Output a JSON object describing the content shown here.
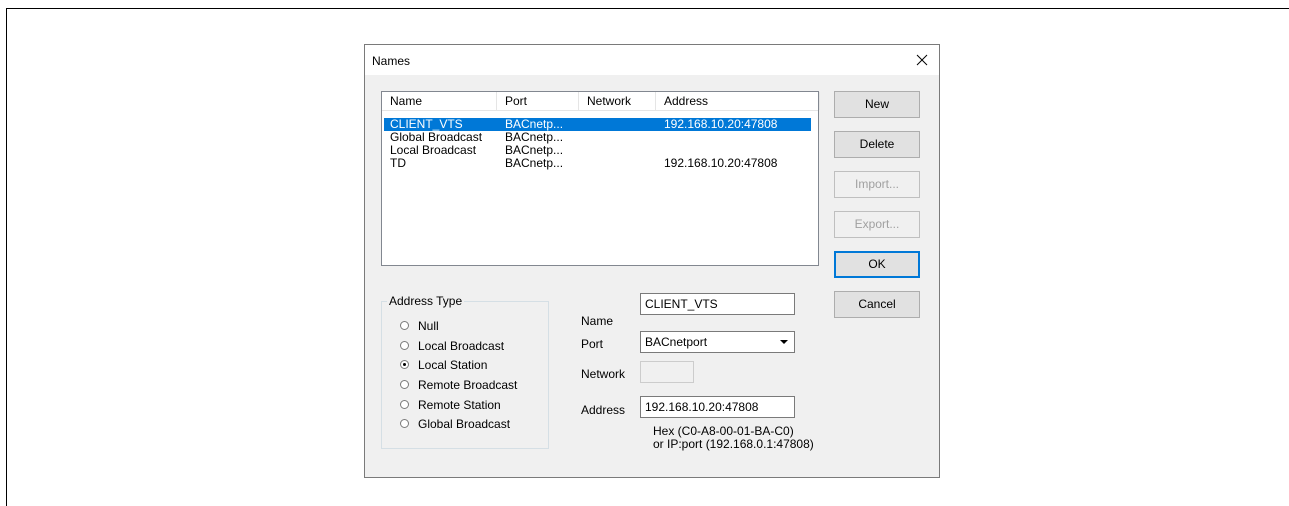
{
  "dialog": {
    "title": "Names"
  },
  "list": {
    "columns": [
      "Name",
      "Port",
      "Network",
      "Address"
    ],
    "rows": [
      {
        "name": "CLIENT_VTS",
        "port": "BACnetp...",
        "network": "",
        "address": "192.168.10.20:47808",
        "selected": true
      },
      {
        "name": "Global Broadcast",
        "port": "BACnetp...",
        "network": "",
        "address": ""
      },
      {
        "name": "Local Broadcast",
        "port": "BACnetp...",
        "network": "",
        "address": ""
      },
      {
        "name": "TD",
        "port": "BACnetp...",
        "network": "",
        "address": "192.168.10.20:47808"
      }
    ]
  },
  "buttons": {
    "new": "New",
    "delete": "Delete",
    "import": "Import...",
    "export": "Export...",
    "ok": "OK",
    "cancel": "Cancel"
  },
  "address_type": {
    "legend": "Address Type",
    "options": [
      "Null",
      "Local Broadcast",
      "Local Station",
      "Remote Broadcast",
      "Remote Station",
      "Global Broadcast"
    ],
    "selected": "Local Station"
  },
  "form": {
    "name_label": "Name",
    "name_value": "CLIENT_VTS",
    "port_label": "Port",
    "port_value": "BACnetport",
    "network_label": "Network",
    "network_value": "",
    "address_label": "Address",
    "address_value": "192.168.10.20:47808",
    "hint_line1": "Hex  (C0-A8-00-01-BA-C0)",
    "hint_line2": "or IP:port (192.168.0.1:47808)"
  },
  "colors": {
    "selection": "#0078d7",
    "dialog_bg": "#f0f0f0"
  },
  "icons": {
    "close": "close-icon",
    "dropdown": "chevron-down-icon"
  }
}
